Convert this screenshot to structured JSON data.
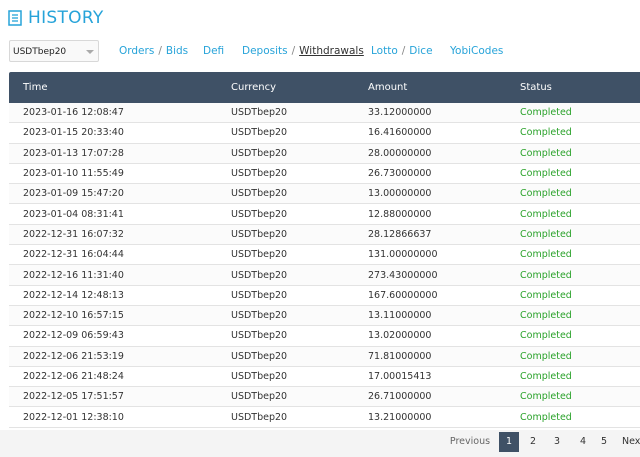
{
  "header": {
    "title": "HISTORY",
    "icon": "document-icon"
  },
  "currency_select": {
    "value": "USDTbep20"
  },
  "nav": {
    "orders": "Orders",
    "bids": "Bids",
    "defi": "Defi",
    "deposits": "Deposits",
    "withdrawals": "Withdrawals",
    "lotto": "Lotto",
    "dice": "Dice",
    "yobicodes": "YobiCodes",
    "separator": "/"
  },
  "table": {
    "columns": [
      "Time",
      "Currency",
      "Amount",
      "Status"
    ],
    "rows": [
      {
        "time": "2023-01-16 12:08:47",
        "currency": "USDTbep20",
        "amount": "33.12000000",
        "status": "Completed"
      },
      {
        "time": "2023-01-15 20:33:40",
        "currency": "USDTbep20",
        "amount": "16.41600000",
        "status": "Completed"
      },
      {
        "time": "2023-01-13 17:07:28",
        "currency": "USDTbep20",
        "amount": "28.00000000",
        "status": "Completed"
      },
      {
        "time": "2023-01-10 11:55:49",
        "currency": "USDTbep20",
        "amount": "26.73000000",
        "status": "Completed"
      },
      {
        "time": "2023-01-09 15:47:20",
        "currency": "USDTbep20",
        "amount": "13.00000000",
        "status": "Completed"
      },
      {
        "time": "2023-01-04 08:31:41",
        "currency": "USDTbep20",
        "amount": "12.88000000",
        "status": "Completed"
      },
      {
        "time": "2022-12-31 16:07:32",
        "currency": "USDTbep20",
        "amount": "28.12866637",
        "status": "Completed"
      },
      {
        "time": "2022-12-31 16:04:44",
        "currency": "USDTbep20",
        "amount": "131.00000000",
        "status": "Completed"
      },
      {
        "time": "2022-12-16 11:31:40",
        "currency": "USDTbep20",
        "amount": "273.43000000",
        "status": "Completed"
      },
      {
        "time": "2022-12-14 12:48:13",
        "currency": "USDTbep20",
        "amount": "167.60000000",
        "status": "Completed"
      },
      {
        "time": "2022-12-10 16:57:15",
        "currency": "USDTbep20",
        "amount": "13.11000000",
        "status": "Completed"
      },
      {
        "time": "2022-12-09 06:59:43",
        "currency": "USDTbep20",
        "amount": "13.02000000",
        "status": "Completed"
      },
      {
        "time": "2022-12-06 21:53:19",
        "currency": "USDTbep20",
        "amount": "71.81000000",
        "status": "Completed"
      },
      {
        "time": "2022-12-06 21:48:24",
        "currency": "USDTbep20",
        "amount": "17.00015413",
        "status": "Completed"
      },
      {
        "time": "2022-12-05 17:51:57",
        "currency": "USDTbep20",
        "amount": "26.71000000",
        "status": "Completed"
      },
      {
        "time": "2022-12-01 12:38:10",
        "currency": "USDTbep20",
        "amount": "13.21000000",
        "status": "Completed"
      }
    ]
  },
  "pagination": {
    "previous": "Previous",
    "pages": [
      "1",
      "2",
      "3",
      "4",
      "5"
    ],
    "current": "1",
    "next": "Next"
  },
  "colors": {
    "accent": "#26a3d9",
    "header_bg": "#3f5166",
    "status_completed": "#2aa22a"
  }
}
